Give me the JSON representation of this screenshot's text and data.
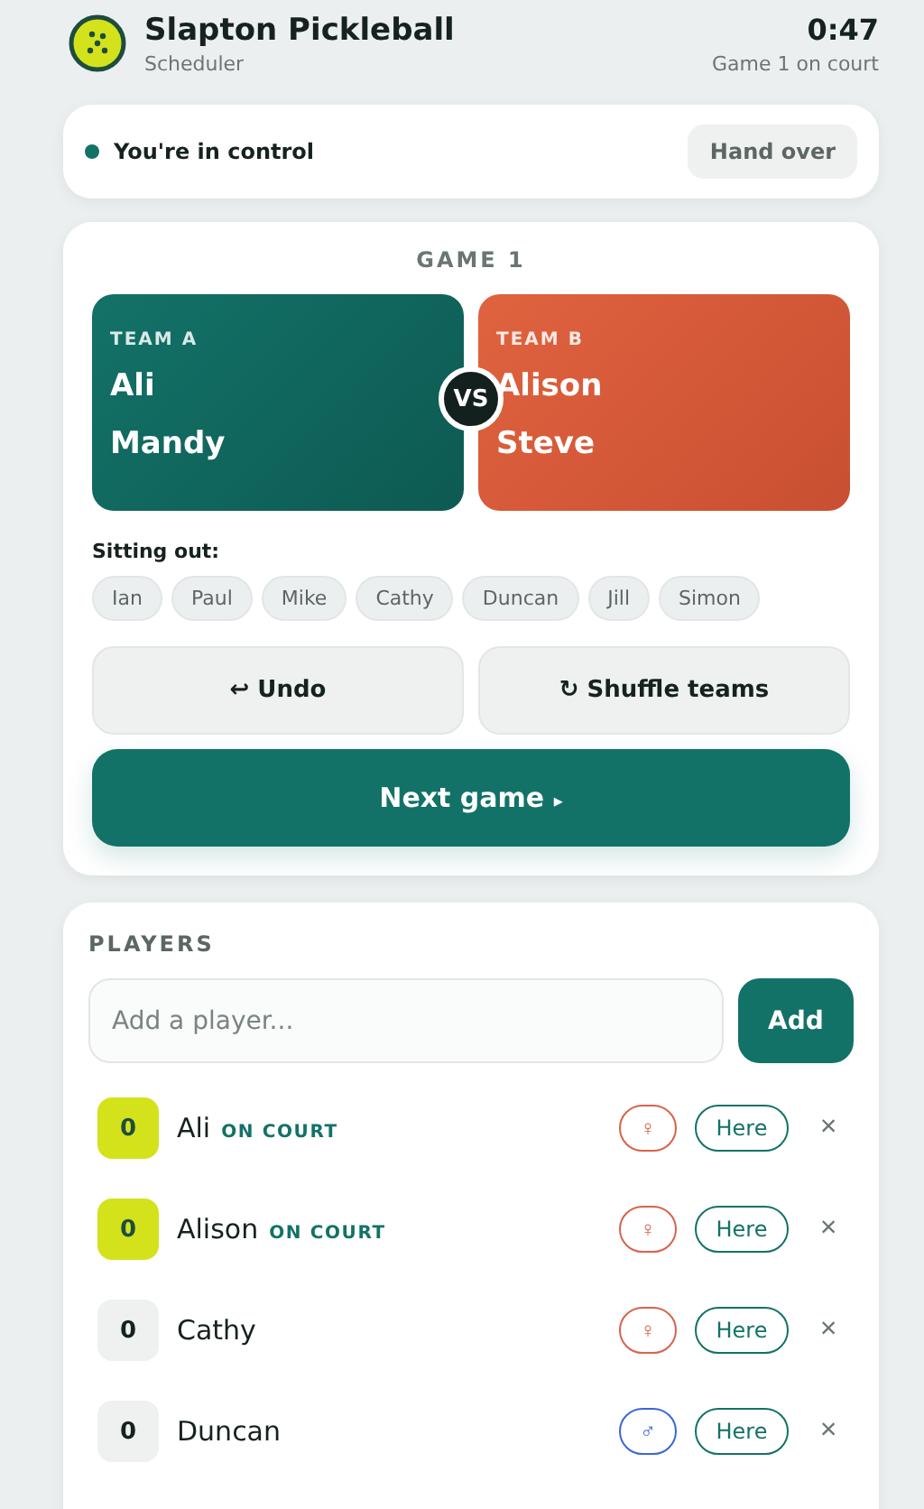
{
  "header": {
    "title": "Slapton Pickleball",
    "subtitle": "Scheduler",
    "timer": "0:47",
    "status": "Game 1 on court"
  },
  "control": {
    "label": "You're in control",
    "active": true,
    "button": "Hand over"
  },
  "game": {
    "title": "GAME 1",
    "vs": "VS",
    "teams": [
      {
        "kind": "a",
        "label": "TEAM A",
        "players": [
          "Ali",
          "Mandy"
        ]
      },
      {
        "kind": "b",
        "label": "TEAM B",
        "players": [
          "Alison",
          "Steve"
        ]
      }
    ],
    "sitting_out_label": "Sitting out:",
    "sitting_out": [
      "Ian",
      "Paul",
      "Mike",
      "Cathy",
      "Duncan",
      "Jill",
      "Simon"
    ],
    "buttons": [
      {
        "icon": "↩",
        "label": "Undo"
      },
      {
        "icon": "↻",
        "label": "Shuffle teams"
      }
    ],
    "next": {
      "label": "Next game",
      "icon": "▸"
    }
  },
  "players": {
    "title": "PLAYERS",
    "placeholder": "Add a player...",
    "add_button": "Add",
    "rows": [
      {
        "score": "0",
        "name": "Ali",
        "on_court": true,
        "status": "ON COURT",
        "gender": "♀",
        "color": "#d9624a",
        "presence": "Here",
        "remove": "×"
      },
      {
        "score": "0",
        "name": "Alison",
        "on_court": true,
        "status": "ON COURT",
        "gender": "♀",
        "color": "#d9624a",
        "presence": "Here",
        "remove": "×"
      },
      {
        "score": "0",
        "name": "Cathy",
        "on_court": false,
        "gender": "♀",
        "color": "#d9624a",
        "presence": "Here",
        "remove": "×"
      },
      {
        "score": "0",
        "name": "Duncan",
        "on_court": false,
        "gender": "♂",
        "color": "#3b67d6",
        "presence": "Here",
        "remove": "×"
      }
    ]
  }
}
